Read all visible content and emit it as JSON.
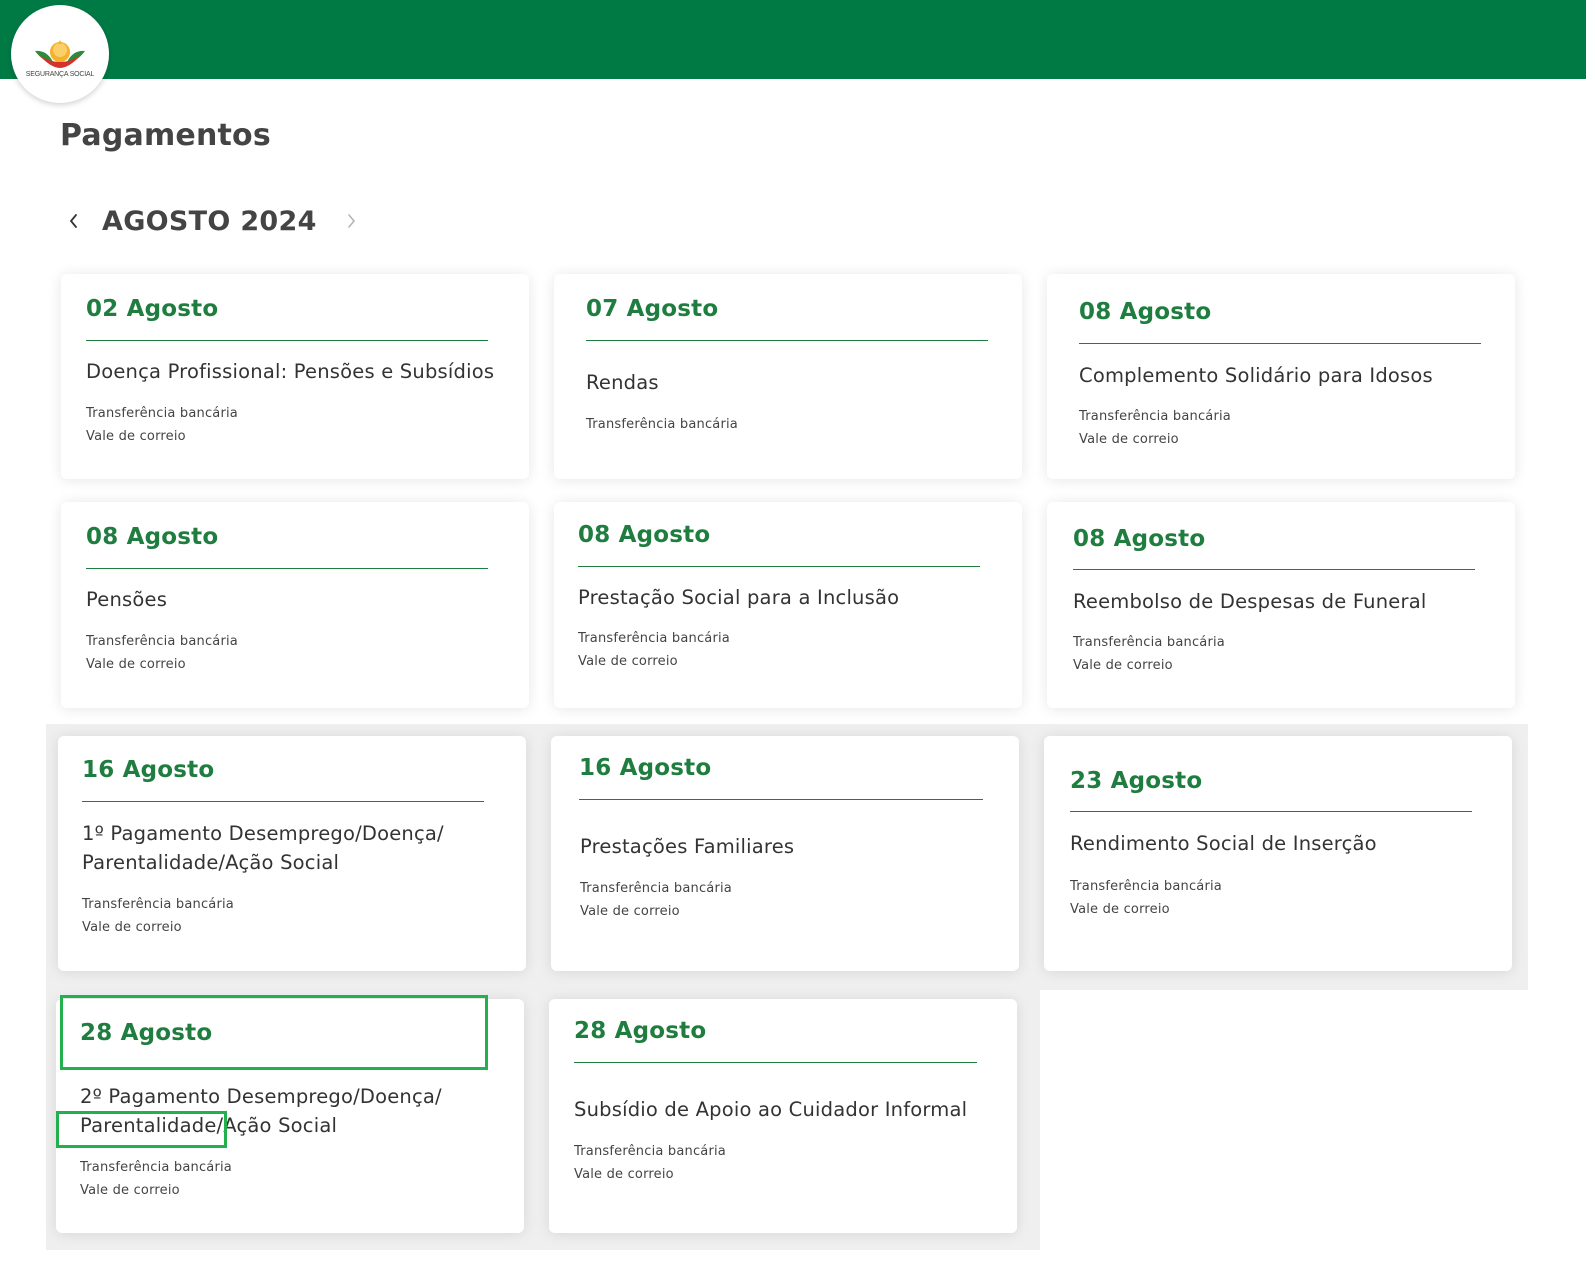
{
  "header": {
    "brand_color": "#007a45",
    "logo": {
      "icon": "seguranca-social-logo-icon",
      "text": "SEGURANÇA SOCIAL"
    }
  },
  "page": {
    "title": "Pagamentos"
  },
  "month_nav": {
    "label": "AGOSTO 2024",
    "prev_icon": "chevron-left-icon",
    "next_icon": "chevron-right-icon"
  },
  "accent_color": "#1f7d3f",
  "cards": [
    {
      "date": "02 Agosto",
      "title": "Doença Profissional: Pensões e Subsídios",
      "methods": [
        "Transferência bancária",
        "Vale de correio"
      ]
    },
    {
      "date": "07 Agosto",
      "title": "Rendas",
      "methods": [
        "Transferência bancária"
      ]
    },
    {
      "date": "08 Agosto",
      "title": "Complemento Solidário para Idosos",
      "methods": [
        "Transferência bancária",
        "Vale de correio"
      ]
    },
    {
      "date": "08 Agosto",
      "title": "Pensões",
      "methods": [
        "Transferência bancária",
        "Vale de correio"
      ]
    },
    {
      "date": "08 Agosto",
      "title": "Prestação Social para a Inclusão",
      "methods": [
        "Transferência bancária",
        "Vale de correio"
      ]
    },
    {
      "date": "08 Agosto",
      "title": "Reembolso de Despesas de Funeral",
      "methods": [
        "Transferência bancária",
        "Vale de correio"
      ]
    },
    {
      "date": "16 Agosto",
      "title_lines": [
        "1º Pagamento Desemprego/Doença/",
        "Parentalidade/Ação Social"
      ],
      "methods": [
        "Transferência bancária",
        "Vale de correio"
      ]
    },
    {
      "date": "16 Agosto",
      "title": "Prestações Familiares",
      "methods": [
        "Transferência bancária",
        "Vale de correio"
      ]
    },
    {
      "date": "23 Agosto",
      "title": "Rendimento Social de Inserção",
      "methods": [
        "Transferência bancária",
        "Vale de correio"
      ]
    },
    {
      "date": "28 Agosto",
      "title_lines": [
        "2º Pagamento Desemprego/Doença/",
        "Parentalidade/Ação Social"
      ],
      "methods": [
        "Transferência bancária",
        "Vale de correio"
      ]
    },
    {
      "date": "28 Agosto",
      "title": "Subsídio de Apoio ao Cuidador Informal",
      "methods": [
        "Transferência bancária",
        "Vale de correio"
      ]
    }
  ],
  "highlight_color": "#22b14c"
}
